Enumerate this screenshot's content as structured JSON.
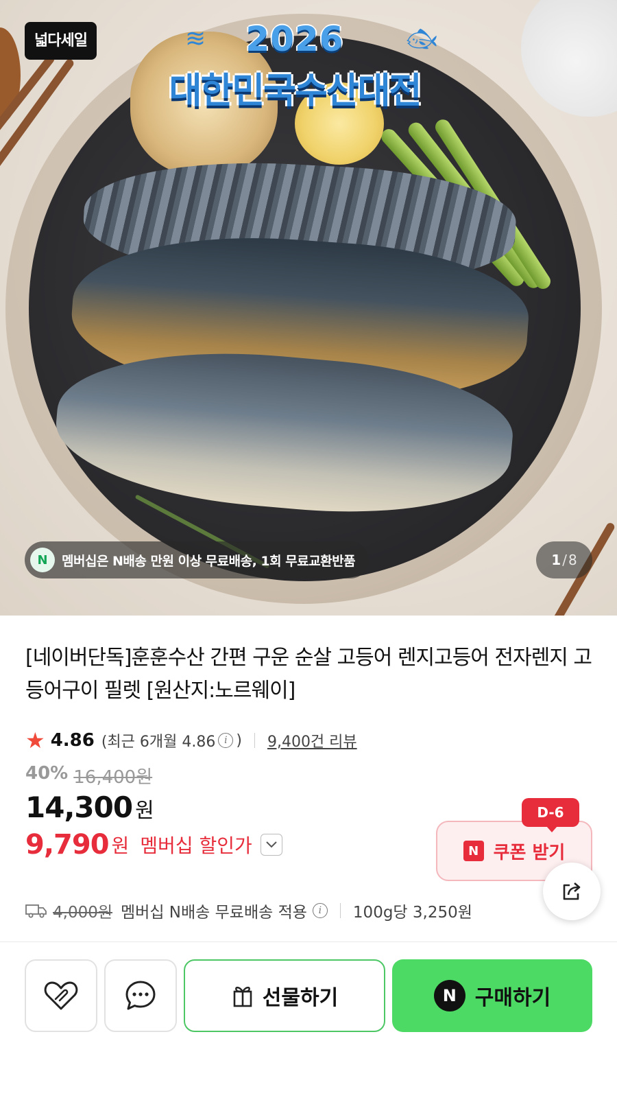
{
  "hero": {
    "badge": "넓다세일",
    "event_year": "2026",
    "event_name": "대한민국수산대전",
    "promo_n": "N",
    "promo_text": "멤버십은 N배송 만원 이상 무료배송, 1회 무료교환반품",
    "page_current": "1",
    "page_sep": "/",
    "page_total": "8"
  },
  "product": {
    "title": "[네이버단독]훈훈수산 간편 구운 순살 고등어 렌지고등어 전자렌지 고등어구이 필렛 [원산지:노르웨이]",
    "rating": "4.86",
    "recent_rating_label": "(최근 6개월 4.86",
    "recent_rating_close": ")",
    "review_count": "9,400건 리뷰"
  },
  "price": {
    "discount_rate": "40%",
    "original_price": "16,400원",
    "sale_price": "14,300",
    "sale_currency": "원",
    "member_price": "9,790",
    "member_currency": "원",
    "member_label": "멤버십 할인가"
  },
  "coupon": {
    "dday": "D-6",
    "n_mark": "N",
    "label": "쿠폰 받기"
  },
  "shipping": {
    "original_fee": "4,000원",
    "text": "멤버십 N배송 무료배송 적용",
    "unit_price": "100g당 3,250원"
  },
  "actions": {
    "gift_label": "선물하기",
    "buy_n": "N",
    "buy_label": "구매하기"
  },
  "colors": {
    "accent_red": "#e72d3b",
    "naver_green": "#4cd964",
    "star": "#f04a3a"
  }
}
